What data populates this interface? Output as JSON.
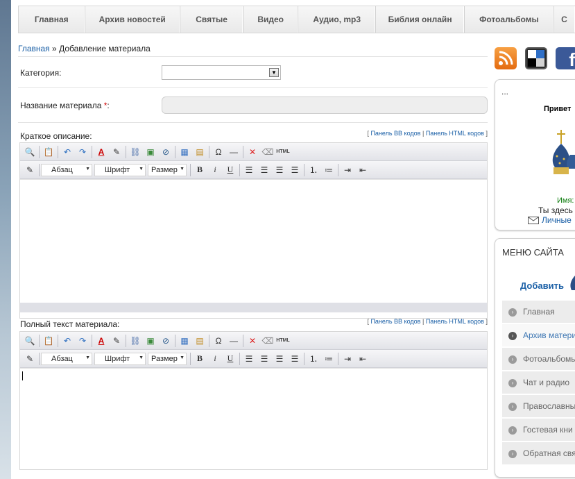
{
  "nav": {
    "items": [
      "Главная",
      "Архив новостей",
      "Святые",
      "Видео",
      "Аудио, mp3",
      "Библия онлайн",
      "Фотоальбомы",
      "С"
    ]
  },
  "breadcrumb": {
    "home": "Главная",
    "separator": "»",
    "current": "Добавление материала"
  },
  "form": {
    "category_label": "Категория:",
    "category_value": "",
    "title_label": "Название материала",
    "required_mark": "*",
    "title_suffix": ":",
    "title_value": "",
    "short_label": "Краткое описание:",
    "full_label": "Полный текст материала:",
    "panel_links": {
      "open": "[",
      "bb": "Панель BB кодов",
      "sep": "|",
      "html": "Панель HTML кодов",
      "close": "]"
    }
  },
  "editor": {
    "paragraph_select": "Абзац",
    "font_select": "Шрифт",
    "size_select": "Размер",
    "bold": "B",
    "italic": "i",
    "underline": "U",
    "html_button": "HTML"
  },
  "sidebar": {
    "user_box": {
      "dots": "...",
      "greeting": "Привет",
      "name_label": "Имя:",
      "here_label": "Ты здесь",
      "messages_link": "Личные"
    },
    "menu": {
      "title": "МЕНЮ САЙТА",
      "add_link": "Добавить",
      "items": [
        "Главная",
        "Архив матери",
        "Фотоальбомы",
        "Чат и радио",
        "Православны",
        "Гостевая кни",
        "Обратная свя"
      ],
      "active_index": 1
    }
  },
  "colors": {
    "link": "#1a5fa6",
    "rss": "#f07d1a",
    "facebook": "#3b5998",
    "active_menu": "#3e77b3"
  }
}
